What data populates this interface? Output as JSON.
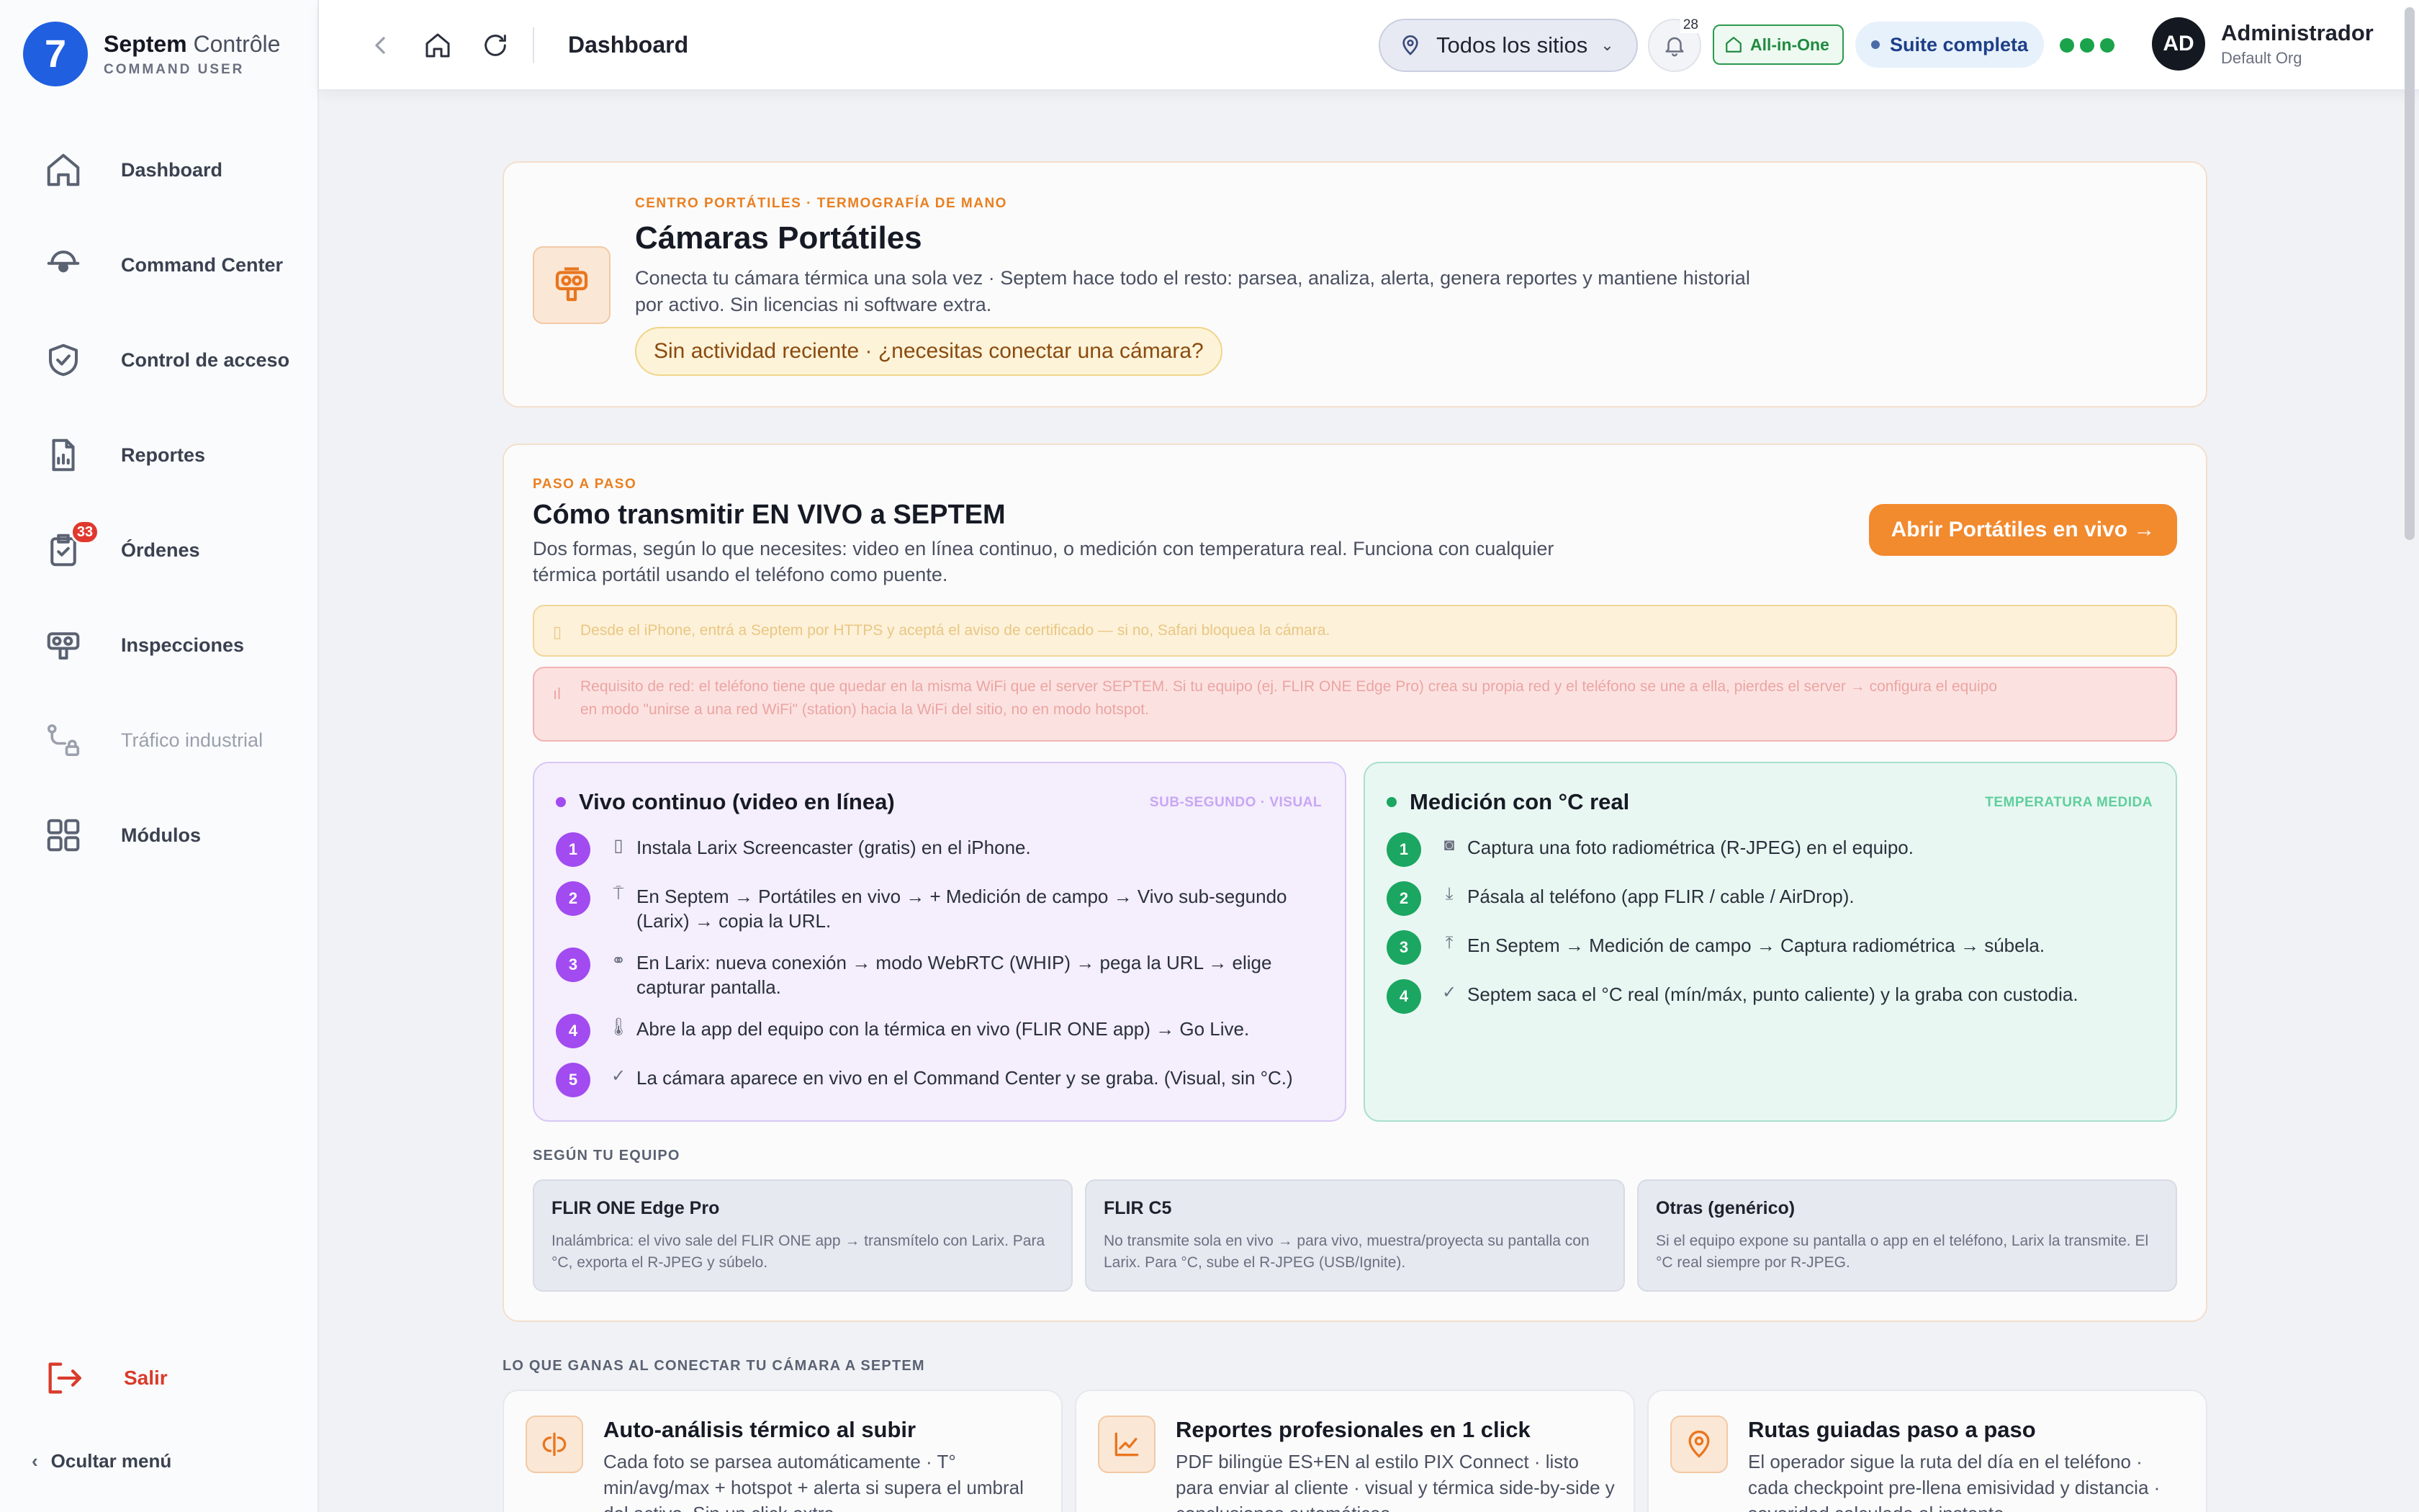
{
  "brand": {
    "logo_glyph": "7",
    "name_bold": "Septem",
    "name_light": " Contrôle",
    "subtitle": "COMMAND USER"
  },
  "sidebar": {
    "items": [
      {
        "label": "Dashboard",
        "icon": "home-icon"
      },
      {
        "label": "Command Center",
        "icon": "dome-camera-icon"
      },
      {
        "label": "Control de acceso",
        "icon": "shield-check-icon"
      },
      {
        "label": "Reportes",
        "icon": "report-file-icon"
      },
      {
        "label": "Órdenes",
        "icon": "clipboard-check-icon",
        "badge": "33"
      },
      {
        "label": "Inspecciones",
        "icon": "thermal-camera-icon"
      },
      {
        "label": "Tráfico industrial",
        "icon": "route-lock-icon",
        "disabled": true
      },
      {
        "label": "Módulos",
        "icon": "grid-icon"
      }
    ],
    "logout": "Salir",
    "hide_menu": "Ocultar menú"
  },
  "topbar": {
    "title": "Dashboard",
    "site_select": "Todos los sitios",
    "notifications": "28",
    "plan_badge": "All-in-One",
    "suite_badge": "Suite completa",
    "user_initials": "AD",
    "user_name": "Administrador",
    "user_org": "Default Org"
  },
  "hero": {
    "eyebrow": "CENTRO PORTÁTILES · TERMOGRAFÍA DE MANO",
    "title": "Cámaras Portátiles",
    "description": "Conecta tu cámara térmica una sola vez · Septem hace todo el resto: parsea, analiza, alerta, genera reportes y mantiene historial por activo. Sin licencias ni software extra.",
    "status_pill": "Sin actividad reciente · ¿necesitas conectar una cámara?"
  },
  "how": {
    "eyebrow": "PASO A PASO",
    "title": "Cómo transmitir EN VIVO a SEPTEM",
    "description": "Dos formas, según lo que necesites: video en línea continuo, o medición con temperatura real. Funciona con cualquier térmica portátil usando el teléfono como puente.",
    "cta": "Abrir Portátiles en vivo →",
    "note_https": "Desde el iPhone, entrá a Septem por HTTPS y aceptá el aviso de certificado — si no, Safari bloquea la cámara.",
    "note_network_1": "Requisito de red: el teléfono tiene que quedar en la misma WiFi que el server SEPTEM. Si tu equipo (ej. FLIR ONE Edge Pro) crea su propia red y el teléfono se une a ella, pierdes el server → configura el equipo",
    "note_network_2": "en modo \"unirse a una red WiFi\" (station) hacia la WiFi del sitio, no en modo hotspot.",
    "live": {
      "title": "Vivo continuo (video en línea)",
      "tag": "SUB-SEGUNDO · VISUAL",
      "steps": [
        {
          "n": "1",
          "icon": "phone-icon",
          "text": "Instala Larix Screencaster (gratis) en el iPhone."
        },
        {
          "n": "2",
          "icon": "antenna-icon",
          "text": "En Septem → Portátiles en vivo → + Medición de campo → Vivo sub-segundo (Larix) → copia la URL."
        },
        {
          "n": "3",
          "icon": "link-icon",
          "text": "En Larix: nueva conexión → modo WebRTC (WHIP) → pega la URL → elige capturar pantalla."
        },
        {
          "n": "4",
          "icon": "thermometer-icon",
          "text": "Abre la app del equipo con la térmica en vivo (FLIR ONE app) → Go Live."
        },
        {
          "n": "5",
          "icon": "check-circle-icon",
          "text": "La cámara aparece en vivo en el Command Center y se graba. (Visual, sin °C.)"
        }
      ]
    },
    "temp": {
      "title": "Medición con °C real",
      "tag": "TEMPERATURA MEDIDA",
      "steps": [
        {
          "n": "1",
          "icon": "camera-icon",
          "text": "Captura una foto radiométrica (R-JPEG) en el equipo."
        },
        {
          "n": "2",
          "icon": "download-icon",
          "text": "Pásala al teléfono (app FLIR / cable / AirDrop)."
        },
        {
          "n": "3",
          "icon": "upload-icon",
          "text": "En Septem → Medición de campo → Captura radiométrica → súbela."
        },
        {
          "n": "4",
          "icon": "check-circle-icon",
          "text": "Septem saca el °C real (mín/máx, punto caliente) y la graba con custodia."
        }
      ]
    },
    "equip_label": "SEGÚN TU EQUIPO",
    "equipment": [
      {
        "title": "FLIR ONE Edge Pro",
        "desc": "Inalámbrica: el vivo sale del FLIR ONE app → transmítelo con Larix. Para °C, exporta el R-JPEG y súbelo."
      },
      {
        "title": "FLIR C5",
        "desc": "No transmite sola en vivo → para vivo, muestra/proyecta su pantalla con Larix. Para °C, sube el R-JPEG (USB/Ignite)."
      },
      {
        "title": "Otras (genérico)",
        "desc": "Si el equipo expone su pantalla o app en el teléfono, Larix la transmite. El °C real siempre por R-JPEG."
      }
    ]
  },
  "gains": {
    "label": "LO QUE GANAS AL CONECTAR TU CÁMARA A SEPTEM",
    "cards": [
      {
        "icon": "thermal-analysis-icon",
        "title": "Auto-análisis térmico al subir",
        "desc": "Cada foto se parsea automáticamente · T° min/avg/max + hotspot + alerta si supera el umbral del activo. Sin un click extra."
      },
      {
        "icon": "chart-icon",
        "title": "Reportes profesionales en 1 click",
        "desc": "PDF bilingüe ES+EN al estilo PIX Connect · listo para enviar al cliente · visual y térmica side-by-side y conclusiones automáticas."
      },
      {
        "icon": "map-pin-icon",
        "title": "Rutas guiadas paso a paso",
        "desc": "El operador sigue la ruta del día en el teléfono · cada checkpoint pre-llena emisividad y distancia · severidad calculada al instante."
      }
    ]
  },
  "colors": {
    "accent": "#f28a2e",
    "brand": "#1f5fe0",
    "live": "#a24bf0",
    "temp": "#1ba661",
    "danger": "#e0382e"
  }
}
